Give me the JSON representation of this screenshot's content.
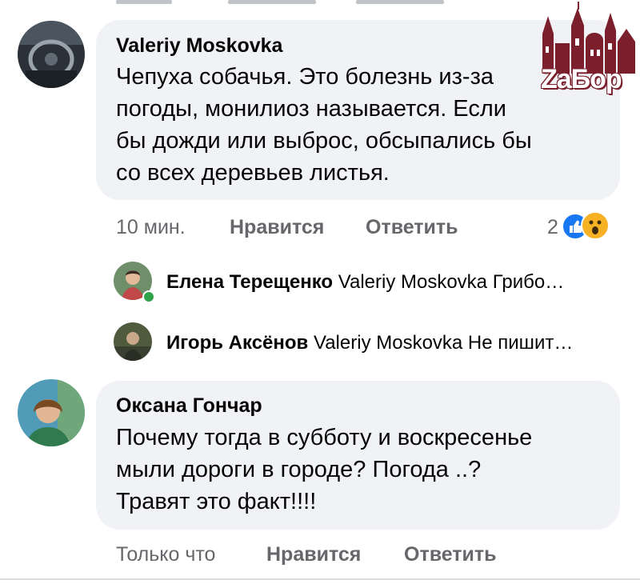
{
  "watermark": {
    "text": "ZаБор",
    "icon": "castle-silhouette-icon"
  },
  "comments": [
    {
      "author": "Valeriy Moskovka",
      "text": "Чепуха собачья. Это болезнь из-за\nпогоды,  монилиоз называется.  Если\nбы дожди или выброс,  обсыпались бы\nсо всех деревьев листья.",
      "time": "10 мин.",
      "like_label": "Нравится",
      "reply_label": "Ответить",
      "reactions": {
        "count": "2",
        "icons": [
          "like-icon",
          "wow-icon"
        ]
      },
      "replies": [
        {
          "author": "Елена Терещенко",
          "preview": "Valeriy Moskovka Грибо…",
          "online": true
        },
        {
          "author": "Игорь Аксёнов",
          "preview": "Valeriy Moskovka Не пишит…",
          "online": false
        }
      ]
    },
    {
      "author": "Оксана Гончар",
      "text": "Почему тогда в субботу и воскресенье\nмыли дороги в городе? Погода ..?\nТравят это факт!!!!",
      "time": "Только что",
      "like_label": "Нравится",
      "reply_label": "Ответить"
    }
  ],
  "colors": {
    "bubble": "#f0f2f5",
    "secondary_text": "#65676b",
    "like_blue": "#1877f2",
    "wow_yellow": "#f7b125",
    "online_green": "#31a24c",
    "watermark_red": "#7a1f2b"
  }
}
